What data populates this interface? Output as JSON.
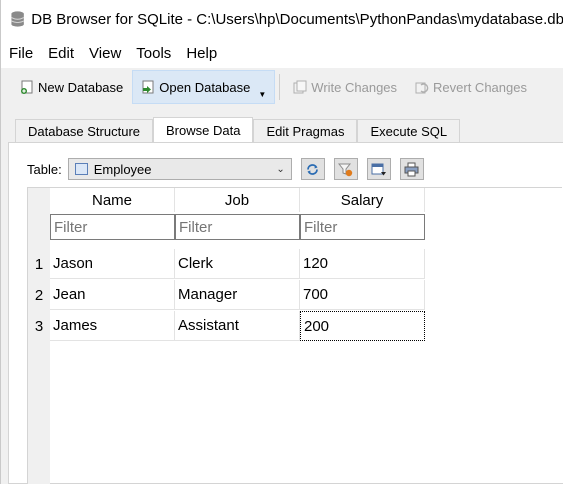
{
  "window": {
    "title": "DB Browser for SQLite - C:\\Users\\hp\\Documents\\PythonPandas\\mydatabase.db",
    "icon": "database-icon"
  },
  "menu": [
    "File",
    "Edit",
    "View",
    "Tools",
    "Help"
  ],
  "toolbar": {
    "new_database": "New Database",
    "open_database": "Open Database",
    "write_changes": "Write Changes",
    "revert_changes": "Revert Changes"
  },
  "tabs": [
    "Database Structure",
    "Browse Data",
    "Edit Pragmas",
    "Execute SQL"
  ],
  "browse": {
    "table_label": "Table:",
    "table_selected": "Employee",
    "columns": [
      "Name",
      "Job",
      "Salary"
    ],
    "filter_placeholder": "Filter",
    "rows": [
      {
        "num": "1",
        "cells": [
          "Jason",
          "Clerk",
          "120"
        ]
      },
      {
        "num": "2",
        "cells": [
          "Jean",
          "Manager",
          "700"
        ]
      },
      {
        "num": "3",
        "cells": [
          "James",
          "Assistant",
          "200"
        ]
      }
    ]
  }
}
